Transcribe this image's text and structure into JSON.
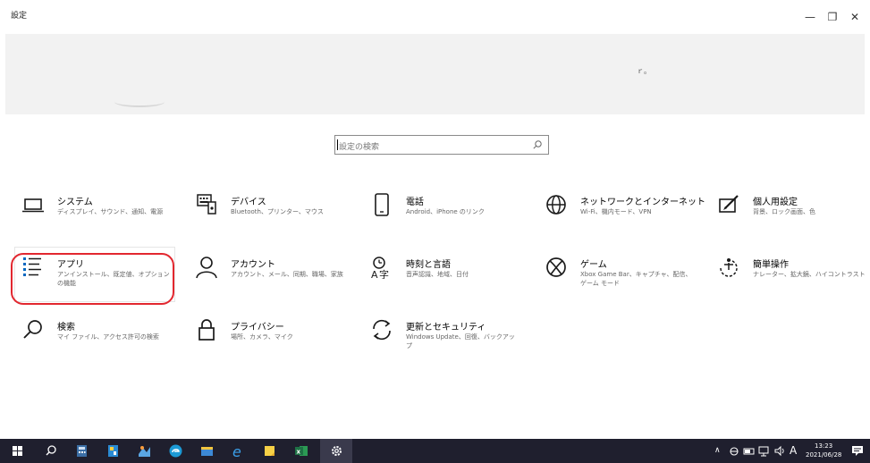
{
  "window": {
    "title": "設定",
    "minimize_glyph": "—",
    "restore_glyph": "❐",
    "close_glyph": "✕"
  },
  "banner": {
    "text": "ｒ。"
  },
  "search": {
    "placeholder": "設定の検索"
  },
  "tiles": [
    {
      "name": "システム",
      "desc": "ディスプレイ、サウンド、通知、電源",
      "icon": "laptop-icon"
    },
    {
      "name": "デバイス",
      "desc": "Bluetooth、プリンター、マウス",
      "icon": "keyboard-icon"
    },
    {
      "name": "電話",
      "desc": "Android、iPhone のリンク",
      "icon": "phone-icon"
    },
    {
      "name": "ネットワークとインターネット",
      "desc": "Wi-Fi、機内モード、VPN",
      "icon": "globe-icon"
    },
    {
      "name": "個人用設定",
      "desc": "背景、ロック画面、色",
      "icon": "pen-tablet-icon"
    },
    {
      "name": "アプリ",
      "desc": "アンインストール、既定値、オプションの機能",
      "icon": "apps-list-icon"
    },
    {
      "name": "アカウント",
      "desc": "アカウント、メール、同期、職場、家族",
      "icon": "person-icon"
    },
    {
      "name": "時刻と言語",
      "desc": "音声認識、地域、日付",
      "icon": "time-language-icon"
    },
    {
      "name": "ゲーム",
      "desc": "Xbox Game Bar、キャプチャ、配信、ゲーム モード",
      "icon": "xbox-icon"
    },
    {
      "name": "簡単操作",
      "desc": "ナレーター、拡大鏡、ハイコントラスト",
      "icon": "ease-of-access-icon"
    },
    {
      "name": "検索",
      "desc": "マイ ファイル、アクセス許可の検索",
      "icon": "search-icon"
    },
    {
      "name": "プライバシー",
      "desc": "場所、カメラ、マイク",
      "icon": "lock-icon"
    },
    {
      "name": "更新とセキュリティ",
      "desc": "Windows Update、回復、バックアップ",
      "icon": "sync-icon"
    }
  ],
  "taskbar": {
    "time": "13:23",
    "date": "2021/06/28",
    "ime": "A"
  },
  "colors": {
    "accent": "#0067c0",
    "highlight": "#e2272f",
    "taskbar": "#1f1f2e"
  }
}
